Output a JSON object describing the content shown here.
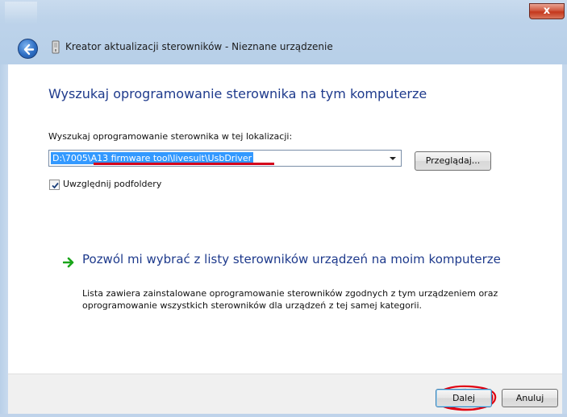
{
  "window": {
    "title": "Kreator aktualizacji sterowników - Nieznane urządzenie",
    "close_glyph": "x"
  },
  "main": {
    "heading": "Wyszukaj oprogramowanie sterownika na tym komputerze",
    "location_label": "Wyszukaj oprogramowanie sterownika w tej lokalizacji:",
    "location_value": "D:\\7005\\A13 firmware tool\\livesuit\\UsbDriver",
    "browse_label": "Przeglądaj...",
    "include_subfolders_label": "Uwzględnij podfoldery",
    "include_subfolders_checked": true
  },
  "command_link": {
    "title": "Pozwól mi wybrać z listy sterowników urządzeń na moim komputerze",
    "description": "Lista zawiera zainstalowane oprogramowanie sterowników zgodnych z tym urządzeniem oraz oprogramowanie wszystkich sterowników dla urządzeń z tej samej kategorii."
  },
  "footer": {
    "next_label": "Dalej",
    "cancel_label": "Anuluj"
  },
  "colors": {
    "accent_blue": "#1e3a8c",
    "selection": "#3399ff",
    "annotation_red": "#d4001a",
    "arrow_green": "#1aa51a"
  },
  "icons": [
    "back-arrow-icon",
    "device-icon",
    "checkmark-icon",
    "green-arrow-icon",
    "close-icon",
    "dropdown-arrow-icon"
  ]
}
